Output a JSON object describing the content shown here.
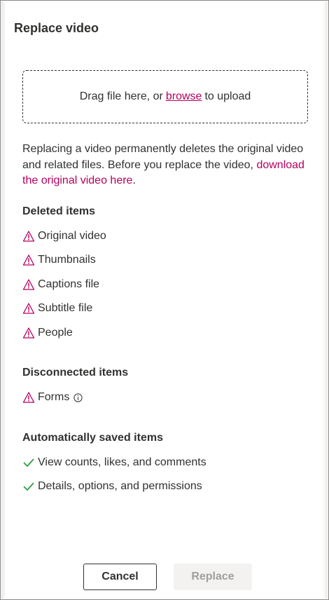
{
  "dialog": {
    "title": "Replace video"
  },
  "dropzone": {
    "prefix": "Drag file here, or",
    "browse_label": "browse",
    "suffix": "to upload"
  },
  "description": {
    "text": "Replacing a video permanently deletes the original video and related files. Before you replace the video, ",
    "link": "download the original video here",
    "after": "."
  },
  "deleted": {
    "heading": "Deleted items",
    "items": [
      {
        "label": "Original video",
        "icon": "warning-icon"
      },
      {
        "label": "Thumbnails",
        "icon": "warning-icon"
      },
      {
        "label": "Captions file",
        "icon": "warning-icon"
      },
      {
        "label": "Subtitle file",
        "icon": "warning-icon"
      },
      {
        "label": "People",
        "icon": "warning-icon"
      }
    ]
  },
  "disconnected": {
    "heading": "Disconnected items",
    "items": [
      {
        "label": "Forms",
        "icon": "warning-icon",
        "extra_icon": "info-icon"
      }
    ]
  },
  "saved": {
    "heading": "Automatically saved items",
    "items": [
      {
        "label": "View counts, likes, and comments",
        "icon": "checkmark-icon"
      },
      {
        "label": "Details, options, and permissions",
        "icon": "checkmark-icon"
      }
    ]
  },
  "buttons": {
    "cancel": "Cancel",
    "replace": "Replace"
  },
  "colors": {
    "accent": "#b4005f",
    "success": "#2ea043",
    "text": "#323130",
    "disabled_bg": "#f3f2f1",
    "disabled_text": "#a19f9d"
  }
}
